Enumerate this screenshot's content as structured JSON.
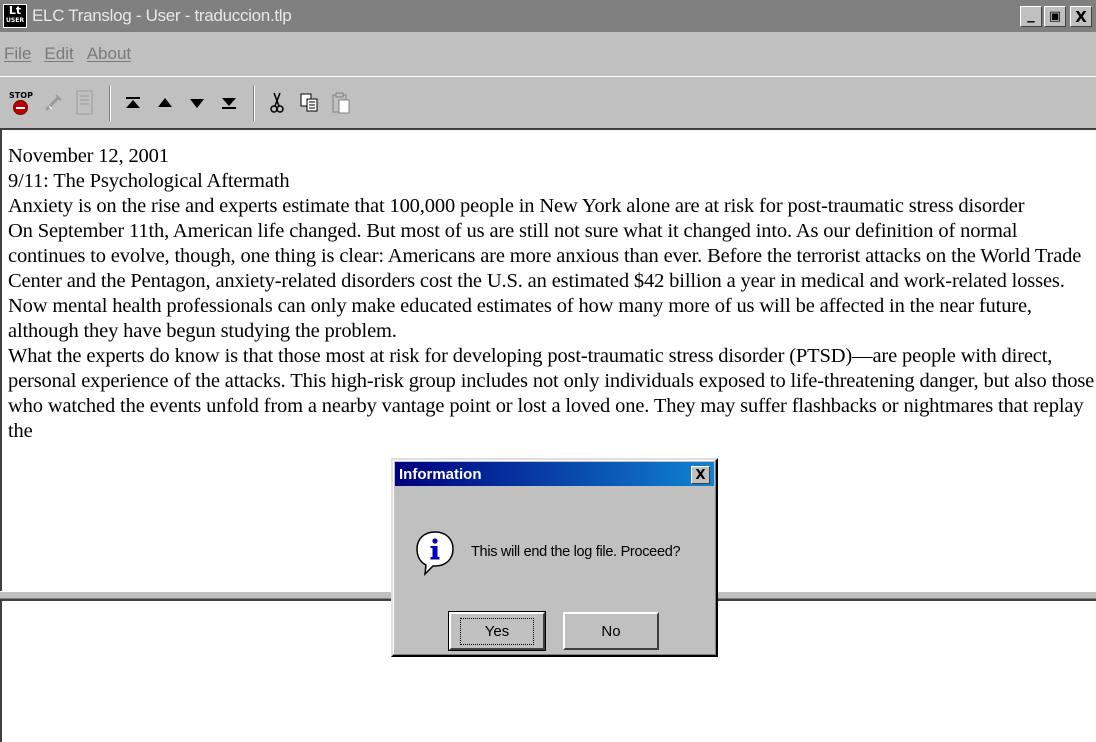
{
  "window": {
    "title": "ELC Translog - User - traduccion.tlp",
    "icon_text_top": "Lt",
    "icon_text_bottom": "USER",
    "minimize_glyph": "_",
    "maximize_glyph": "▣",
    "close_glyph": "X"
  },
  "menu": {
    "items": [
      {
        "label": "File"
      },
      {
        "label": "Edit"
      },
      {
        "label": "About"
      }
    ]
  },
  "toolbar": {
    "stop_label": "STOP",
    "icons": [
      "stop-icon",
      "wand-icon",
      "document-icon",
      "first-icon",
      "up-icon",
      "down-icon",
      "last-icon",
      "cut-icon",
      "copy-icon",
      "paste-icon"
    ]
  },
  "source": {
    "paragraphs": [
      "November 12, 2001",
      "9/11: The Psychological Aftermath",
      "Anxiety is on the rise and experts estimate that 100,000 people in New York alone are at risk for post-traumatic stress disorder",
      "On September 11th, American life changed. But most of us are still not sure what it changed into. As our definition of normal continues to evolve, though, one thing is clear: Americans are more anxious than ever. Before the terrorist attacks on the World Trade Center and the Pentagon, anxiety-related disorders cost the U.S. an estimated $42 billion a year in medical and work-related losses. Now mental health professionals can only make educated estimates of how many more of us will be affected in the near future, although they have begun studying the problem.",
      "What the experts do know is that those most at risk for developing post-traumatic stress disorder (PTSD)—are people with direct, personal experience of the attacks. This high-risk group includes not only individuals exposed to life-threatening danger, but also those who watched the events unfold from a nearby vantage point or lost a loved one. They may suffer flashbacks or nightmares that replay the"
    ]
  },
  "dialog": {
    "title": "Information",
    "message": "This will end the log file. Proceed?",
    "yes_label": "Yes",
    "no_label": "No",
    "close_glyph": "X"
  },
  "colors": {
    "dialog_title_start": "#000080",
    "dialog_title_end": "#1084d0",
    "titlebar_inactive": "#808080"
  }
}
